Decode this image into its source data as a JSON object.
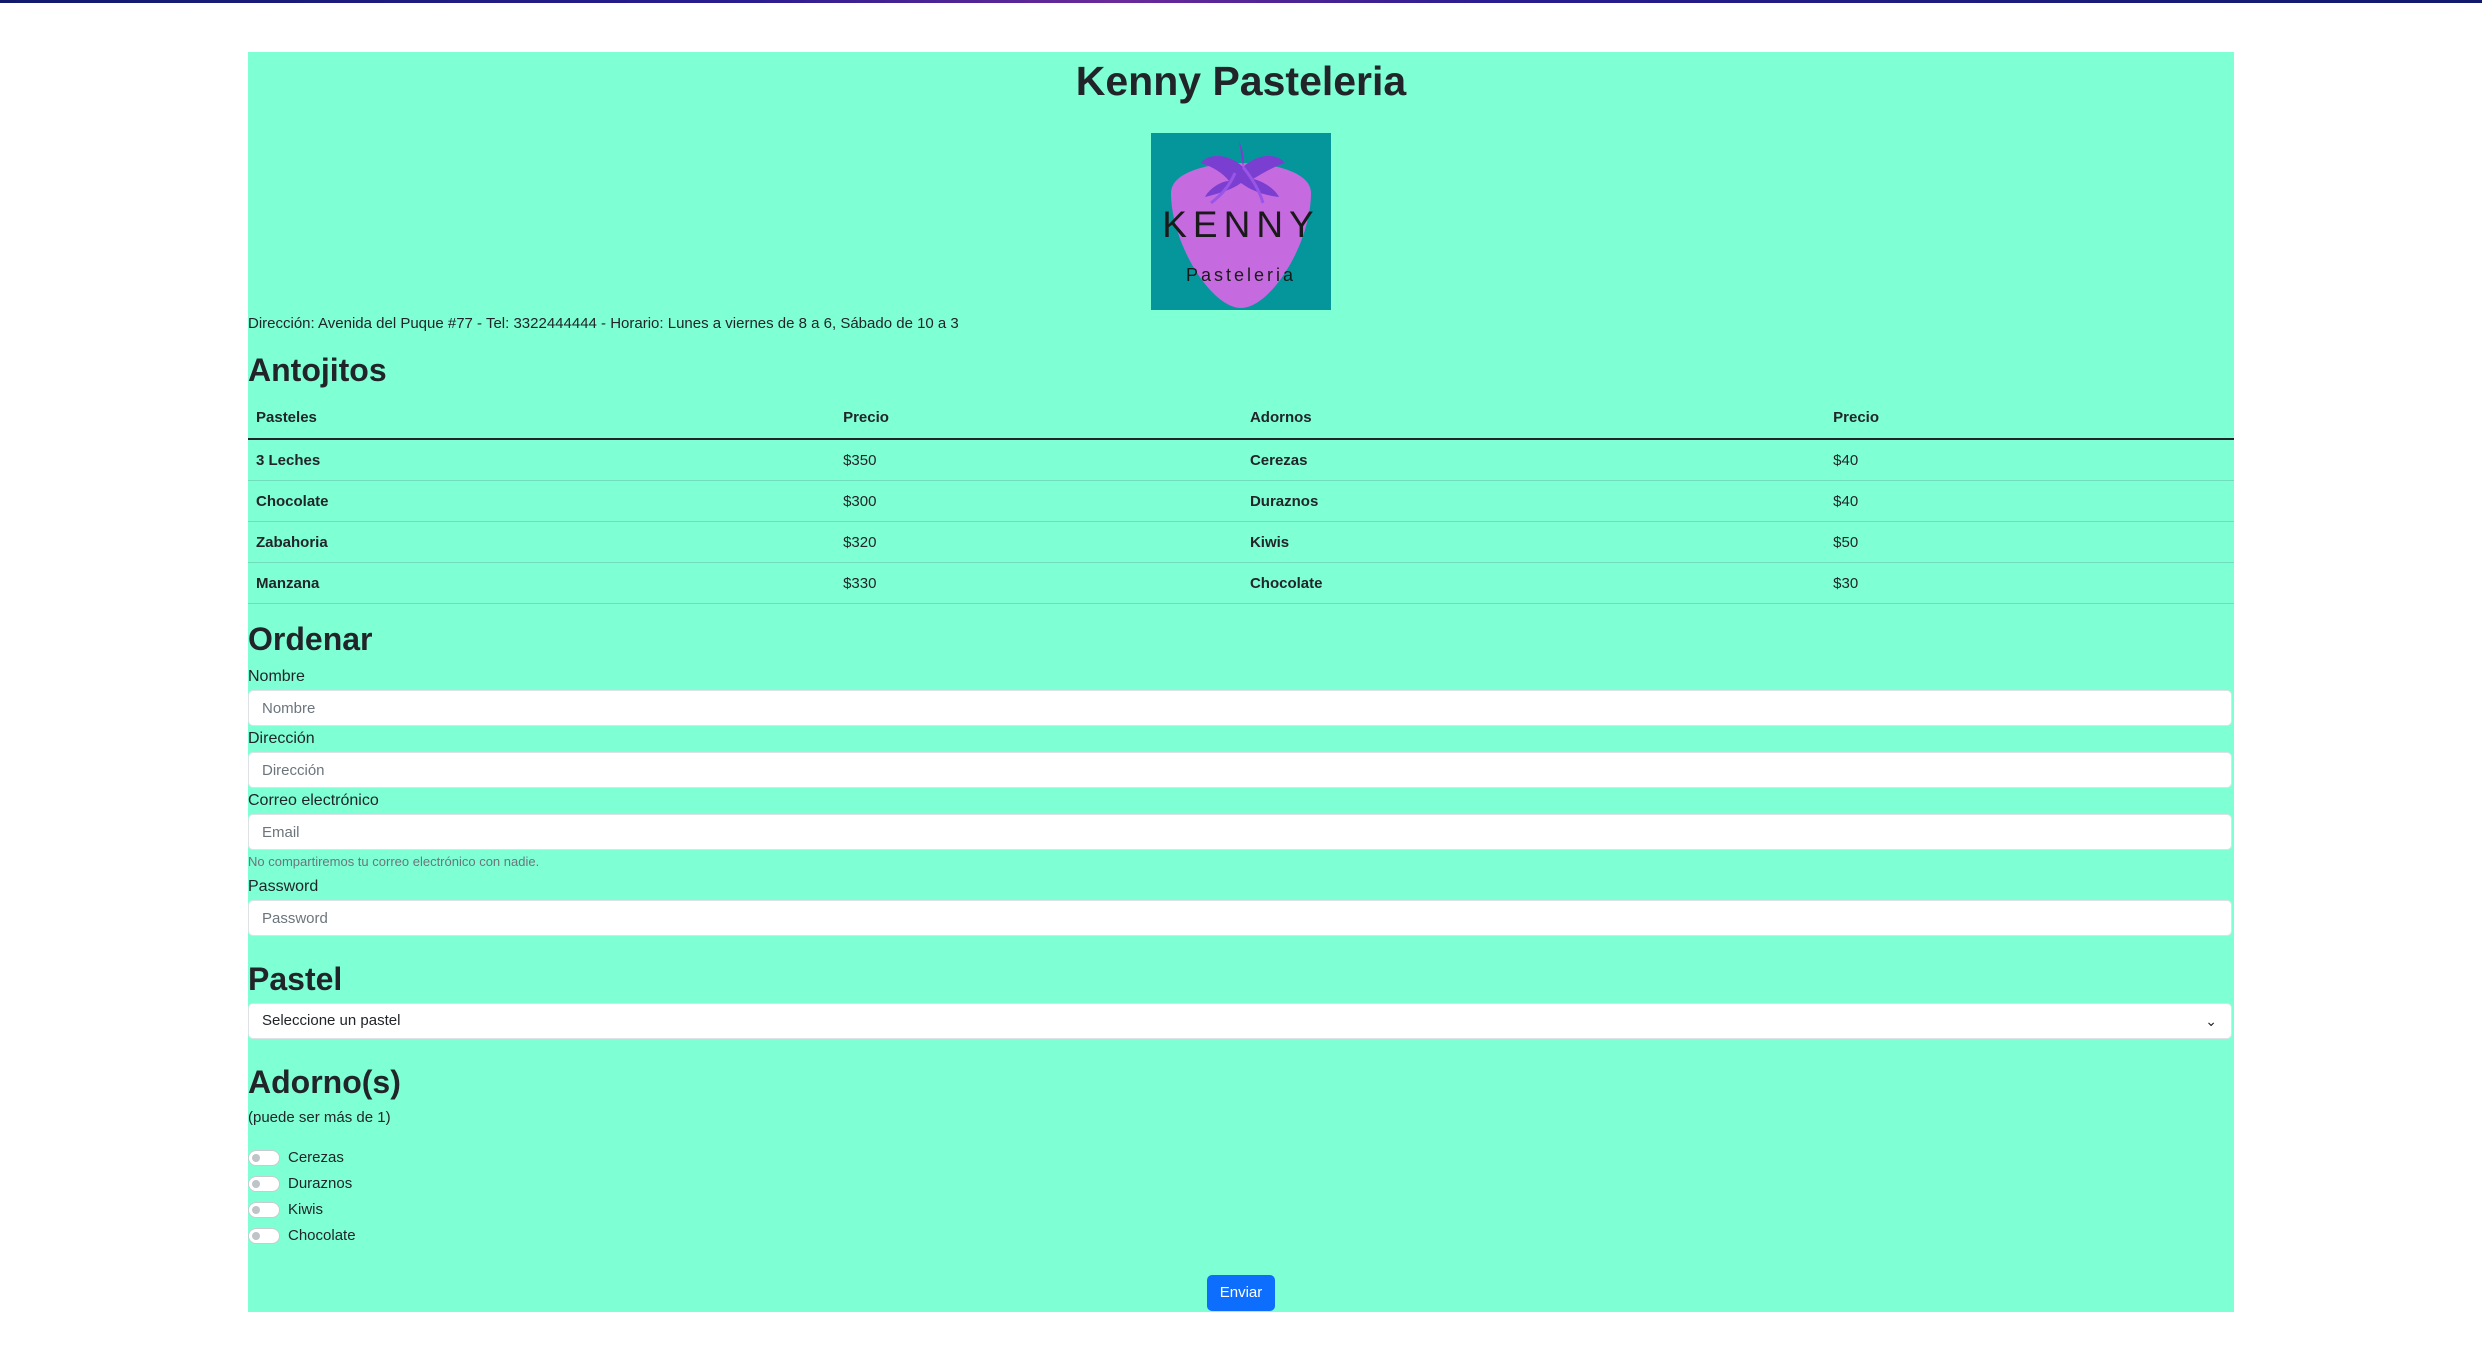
{
  "header": {
    "title": "Kenny Pasteleria"
  },
  "logo": {
    "word": "KENNY",
    "sub": "Pasteleria"
  },
  "info": {
    "address": "Dirección: Avenida del Puque #77 - Tel: 3322444444 - Horario: Lunes a viernes de 8 a 6, Sábado de 10 a 3"
  },
  "menu": {
    "heading": "Antojitos",
    "headers": [
      "Pasteles",
      "Precio",
      "Adornos",
      "Precio"
    ],
    "rows": [
      [
        "3 Leches",
        "$350",
        "Cerezas",
        "$40"
      ],
      [
        "Chocolate",
        "$300",
        "Duraznos",
        "$40"
      ],
      [
        "Zabahoria",
        "$320",
        "Kiwis",
        "$50"
      ],
      [
        "Manzana",
        "$330",
        "Chocolate",
        "$30"
      ]
    ]
  },
  "order": {
    "heading": "Ordenar",
    "name_label": "Nombre",
    "name_placeholder": "Nombre",
    "address_label": "Dirección",
    "address_placeholder": "Dirección",
    "email_label": "Correo electrónico",
    "email_placeholder": "Email",
    "email_help": "No compartiremos tu correo electrónico con nadie.",
    "password_label": "Password",
    "password_placeholder": "Password"
  },
  "pastel": {
    "heading": "Pastel",
    "selected": "Seleccione un pastel"
  },
  "adornos": {
    "heading": "Adorno(s)",
    "note": "(puede ser más de 1)",
    "options": [
      "Cerezas",
      "Duraznos",
      "Kiwis",
      "Chocolate"
    ]
  },
  "submit": {
    "label": "Enviar"
  },
  "colors": {
    "panel": "#7fffd4",
    "button": "#0d6efd",
    "logo_bg": "#05969c",
    "logo_fruit": "#c66ae0"
  }
}
